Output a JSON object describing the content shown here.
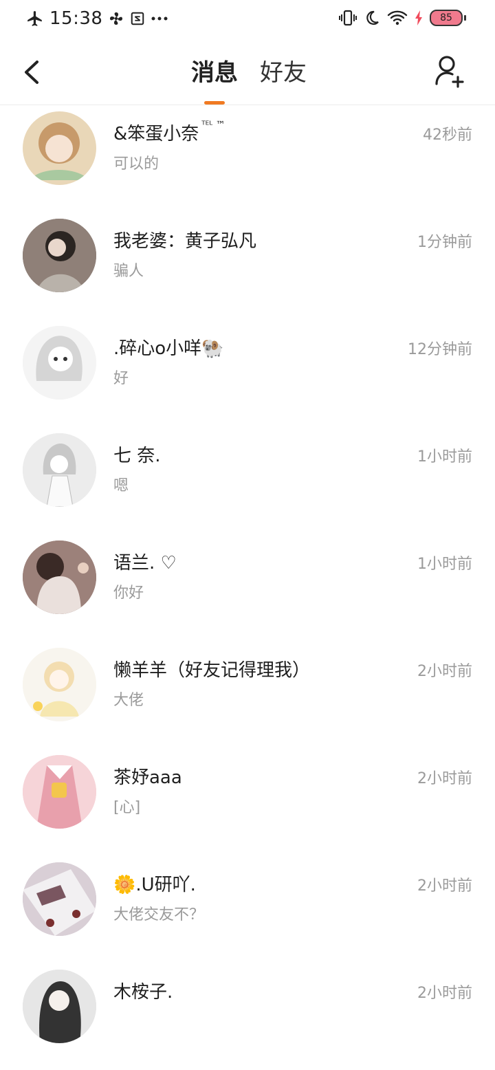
{
  "status_bar": {
    "time": "15:38",
    "left_icons": [
      "airplane-icon",
      "fan-icon",
      "screenshot-icon",
      "more-dots-icon"
    ],
    "right_icons": [
      "vibrate-icon",
      "moon-icon",
      "wifi-icon",
      "charging-bolt-icon"
    ],
    "battery": "85"
  },
  "header": {
    "tabs": [
      {
        "label": "消息",
        "active": true
      },
      {
        "label": "好友",
        "active": false
      }
    ],
    "accent_color": "#f07a22"
  },
  "conversations": [
    {
      "name": "&笨蛋小奈",
      "name_suffix": "ᵀᴱᴸ ™",
      "preview": "可以的",
      "time": "42秒前",
      "avatar": {
        "bg": "#e9d7b8",
        "hair": "#c79a6a"
      }
    },
    {
      "name": "我老婆：黄子弘凡",
      "preview": "骗人",
      "time": "1分钟前",
      "avatar": {
        "bg": "#6b5e55",
        "hair": "#2b2522"
      }
    },
    {
      "name": ".碎心o小咩🐏",
      "preview": "好",
      "time": "12分钟前",
      "avatar": {
        "bg": "#eeeeee",
        "hair": "#d5d5d5"
      }
    },
    {
      "name": "七 奈.",
      "preview": "嗯",
      "time": "1小时前",
      "avatar": {
        "bg": "#e3e3e3",
        "hair": "#c8c8c8"
      }
    },
    {
      "name": "语兰. ♡",
      "preview": "你好",
      "time": "1小时前",
      "avatar": {
        "bg": "#8a6e68",
        "hair": "#3a2a26"
      }
    },
    {
      "name": "懒羊羊（好友记得理我）",
      "preview": "大佬",
      "time": "2小时前",
      "avatar": {
        "bg": "#f4f1ea",
        "hair": "#f3ddb0"
      }
    },
    {
      "name": "茶妤aaa",
      "preview": "[心]",
      "time": "2小时前",
      "avatar": {
        "bg": "#f1c2c8",
        "hair": "#d77c8a"
      }
    },
    {
      "name": "🌼.U研吖.",
      "preview": "大佬交友不？",
      "time": "2小时前",
      "avatar": {
        "bg": "#c9bcc6",
        "hair": "#7a5660"
      }
    },
    {
      "name": "木桉子.",
      "preview": "",
      "time": "2小时前",
      "avatar": {
        "bg": "#dcdcdc",
        "hair": "#333333"
      }
    }
  ]
}
